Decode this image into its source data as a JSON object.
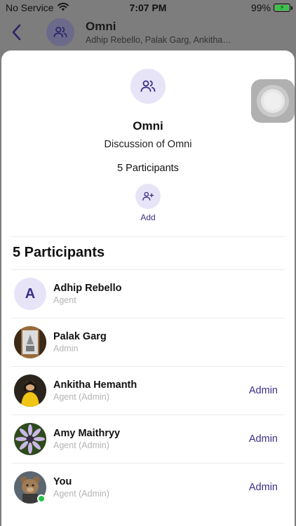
{
  "status_bar": {
    "carrier": "No Service",
    "time": "7:07 PM",
    "battery": "99%",
    "battery_level": 0.99,
    "wifi_icon": "wifi-icon",
    "battery_icon": "battery-charging-icon"
  },
  "header": {
    "title": "Omni",
    "subtitle": "Adhip Rebello, Palak Garg, Ankitha…",
    "back_icon": "chevron-left-icon",
    "avatar_icon": "users-icon"
  },
  "group": {
    "name": "Omni",
    "description": "Discussion of Omni",
    "participant_count_label": "5 Participants",
    "add_label": "Add",
    "avatar_icon": "users-icon",
    "add_icon": "user-plus-icon"
  },
  "participants_section": {
    "title": "5 Participants",
    "items": [
      {
        "name": "Adhip Rebello",
        "role": "Agent",
        "initial": "A",
        "admin_label": ""
      },
      {
        "name": "Palak Garg",
        "role": "Admin",
        "admin_label": ""
      },
      {
        "name": "Ankitha Hemanth",
        "role": "Agent (Admin)",
        "admin_label": "Admin"
      },
      {
        "name": "Amy Maithryy",
        "role": "Agent (Admin)",
        "admin_label": "Admin"
      },
      {
        "name": "You",
        "role": "Agent (Admin)",
        "admin_label": "Admin"
      }
    ]
  },
  "colors": {
    "accent": "#3a2f86",
    "avatar_bg": "#e7e4f8",
    "online": "#22c24b",
    "role_text": "#b4b4b4"
  }
}
